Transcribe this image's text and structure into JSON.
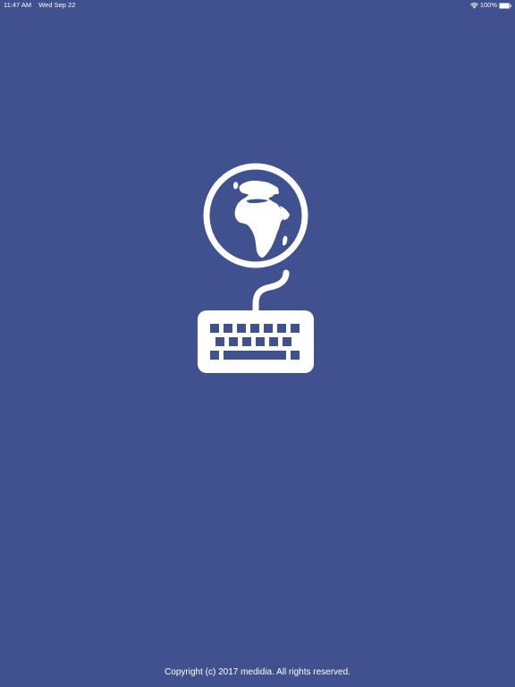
{
  "status_bar": {
    "time": "11:47 AM",
    "date": "Wed Sep 22",
    "battery": "100%",
    "wifi_icon": "wifi-icon",
    "battery_icon": "battery-icon"
  },
  "logo": {
    "icons": [
      "globe-icon",
      "keyboard-icon"
    ]
  },
  "footer": {
    "copyright": "Copyright (c) 2017 medidia. All rights reserved."
  },
  "colors": {
    "background": "#3f518f",
    "foreground": "#ffffff"
  }
}
